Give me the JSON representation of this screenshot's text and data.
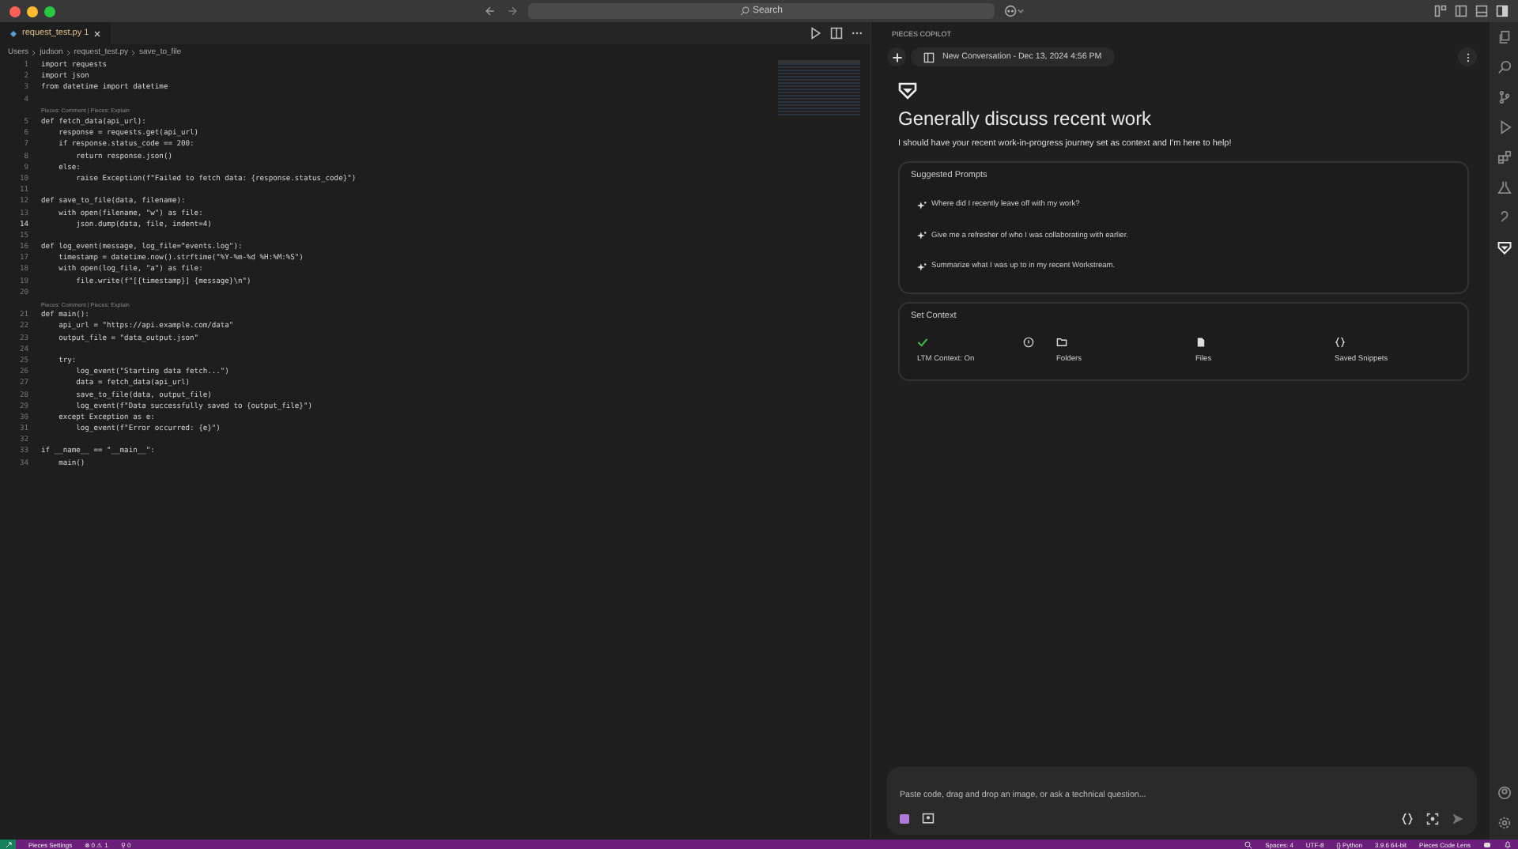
{
  "titlebar": {
    "search": "Search"
  },
  "editor": {
    "tab": {
      "label": "request_test.py",
      "problems": "1",
      "selected": true
    },
    "breadcrumb": [
      "Users",
      "judson",
      "request_test.py",
      "save_to_file"
    ],
    "lines": [
      {
        "kind": "code",
        "number": "1",
        "text": "import requests"
      },
      {
        "kind": "code",
        "number": "2",
        "text": "import json"
      },
      {
        "kind": "code",
        "number": "3",
        "text": "from datetime import datetime"
      },
      {
        "kind": "code",
        "number": "4"
      },
      {
        "kind": "lens",
        "text": "Pieces: Comment | Pieces: Explain"
      },
      {
        "kind": "code",
        "number": "5",
        "text": "def fetch_data(api_url):"
      },
      {
        "kind": "code",
        "number": "6",
        "text": "    response = requests.get(api_url)"
      },
      {
        "kind": "code",
        "number": "7",
        "text": "    if response.status_code == 200:"
      },
      {
        "kind": "code",
        "number": "8",
        "text": "        return response.json()"
      },
      {
        "kind": "code",
        "number": "9",
        "text": "    else:"
      },
      {
        "kind": "code",
        "number": "10",
        "text": "        raise Exception(f\"Failed to fetch data: {response.status_code}\")"
      },
      {
        "kind": "code",
        "number": "11"
      },
      {
        "kind": "code",
        "number": "12",
        "text": "def save_to_file(data, filename):"
      },
      {
        "kind": "code",
        "number": "13",
        "text": "    with open(filename, \"w\") as file:"
      },
      {
        "kind": "code",
        "number": "14",
        "text": "        json.dump(data, file, indent=4)",
        "current": true
      },
      {
        "kind": "code",
        "number": "15"
      },
      {
        "kind": "code",
        "number": "16",
        "text": "def log_event(message, log_file=\"events.log\"):"
      },
      {
        "kind": "code",
        "number": "17",
        "text": "    timestamp = datetime.now().strftime(\"%Y-%m-%d %H:%M:%S\")"
      },
      {
        "kind": "code",
        "number": "18",
        "text": "    with open(log_file, \"a\") as file:"
      },
      {
        "kind": "code",
        "number": "19",
        "text": "        file.write(f\"[{timestamp}] {message}\\n\")"
      },
      {
        "kind": "code",
        "number": "20"
      },
      {
        "kind": "lens",
        "text": "Pieces: Comment | Pieces: Explain"
      },
      {
        "kind": "code",
        "number": "21",
        "text": "def main():"
      },
      {
        "kind": "code",
        "number": "22",
        "text": "    api_url = \"https://api.example.com/data\""
      },
      {
        "kind": "code",
        "number": "23",
        "text": "    output_file = \"data_output.json\""
      },
      {
        "kind": "code",
        "number": "24"
      },
      {
        "kind": "code",
        "number": "25",
        "text": "    try:"
      },
      {
        "kind": "code",
        "number": "26",
        "text": "        log_event(\"Starting data fetch...\")"
      },
      {
        "kind": "code",
        "number": "27",
        "text": "        data = fetch_data(api_url)"
      },
      {
        "kind": "code",
        "number": "28",
        "text": "        save_to_file(data, output_file)"
      },
      {
        "kind": "code",
        "number": "29",
        "text": "        log_event(f\"Data successfully saved to {output_file}\")"
      },
      {
        "kind": "code",
        "number": "30",
        "text": "    except Exception as e:"
      },
      {
        "kind": "code",
        "number": "31",
        "text": "        log_event(f\"Error occurred: {e}\")"
      },
      {
        "kind": "code",
        "number": "32"
      },
      {
        "kind": "code",
        "number": "33",
        "text": "if __name__ == \"__main__\":"
      },
      {
        "kind": "code",
        "number": "34",
        "text": "    main()"
      }
    ]
  },
  "copilot": {
    "panel_title": "PIECES COPILOT",
    "conversation": "New Conversation - Dec 13, 2024 4:56 PM",
    "heading": "Generally discuss recent work",
    "intro": "I should have your recent work-in-progress journey set as context and I'm here to help!",
    "suggested": {
      "title": "Suggested Prompts",
      "prompts": [
        "Where did I recently leave off with my work?",
        "Give me a refresher of who I was collaborating with earlier.",
        "Summarize what I was up to in my recent Workstream."
      ]
    },
    "context": {
      "title": "Set Context",
      "items": [
        {
          "kind": "ltm",
          "label": "LTM Context: On",
          "on": true
        },
        {
          "kind": "folders",
          "label": "Folders"
        },
        {
          "kind": "files",
          "label": "Files"
        },
        {
          "kind": "snippets",
          "label": "Saved Snippets"
        }
      ]
    },
    "input": {
      "placeholder": "Paste code, drag and drop an image, or ask a technical question..."
    }
  },
  "status_bar": {
    "left": [
      "Pieces Settings",
      "⊗ 0 ⚠ 1",
      "⚲ 0"
    ],
    "right": [
      "Spaces: 4",
      "UTF-8",
      "{} Python",
      "3.9.6 64-bit",
      "Pieces Code Lens"
    ]
  }
}
